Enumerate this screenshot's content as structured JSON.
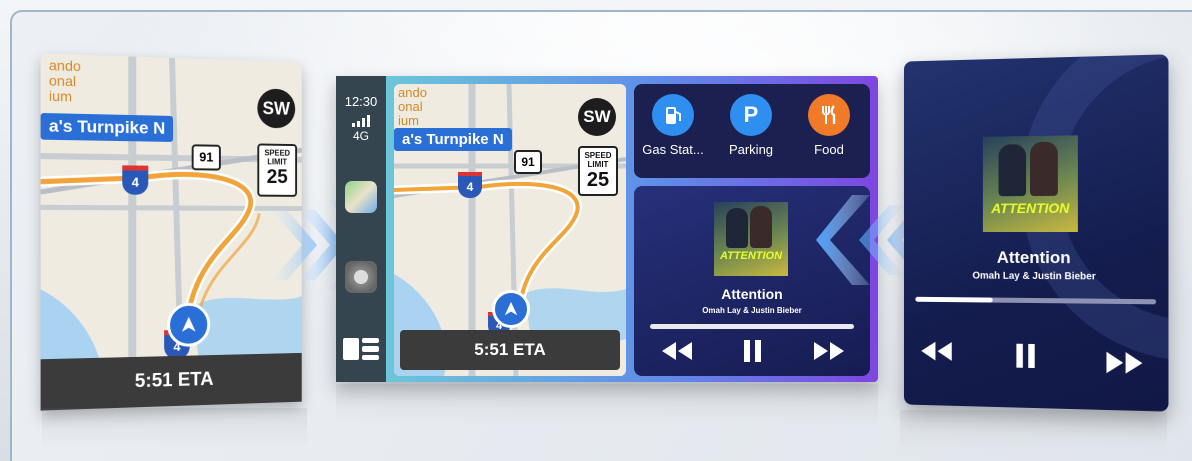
{
  "left_map": {
    "poi_label": "ando\nonal\nium",
    "road_label": "a's Turnpike N",
    "shield_91": "91",
    "shield_4": "4",
    "shield_4b": "4",
    "avatar": "SW",
    "speed_line1": "SPEED",
    "speed_line2": "LIMIT",
    "speed_value": "25",
    "eta": "5:51 ETA"
  },
  "status_bar": {
    "time": "12:30",
    "network": "4G"
  },
  "center_map": {
    "poi_label": "ando\nonal\nium",
    "road_label": "a's Turnpike N",
    "shield_91": "91",
    "shield_4": "4",
    "shield_4b": "4",
    "avatar": "SW",
    "speed_line1": "SPEED",
    "speed_line2": "LIMIT",
    "speed_value": "25",
    "eta": "5:51 ETA"
  },
  "poi_shortcuts": [
    {
      "label": "Gas Stat...",
      "icon": "gas-pump-icon",
      "color": "#2f8ff0"
    },
    {
      "label": "Parking",
      "icon": "parking-icon",
      "glyph": "P",
      "color": "#2f8ff0"
    },
    {
      "label": "Food",
      "icon": "fork-knife-icon",
      "color": "#f07a28"
    }
  ],
  "now_playing_small": {
    "art_text": "ATTENTION",
    "title": "Attention",
    "artist": "Omah Lay & Justin Bieber",
    "progress": 0.0
  },
  "now_playing_large": {
    "art_text": "ATTENTION",
    "title": "Attention",
    "artist": "Omah Lay & Justin Bieber",
    "progress": 0.33
  },
  "colors": {
    "map_bg": "#f1ede3",
    "route": "#f0a43a",
    "water": "#a9d3f1",
    "road_blue": "#2a6fd6"
  }
}
